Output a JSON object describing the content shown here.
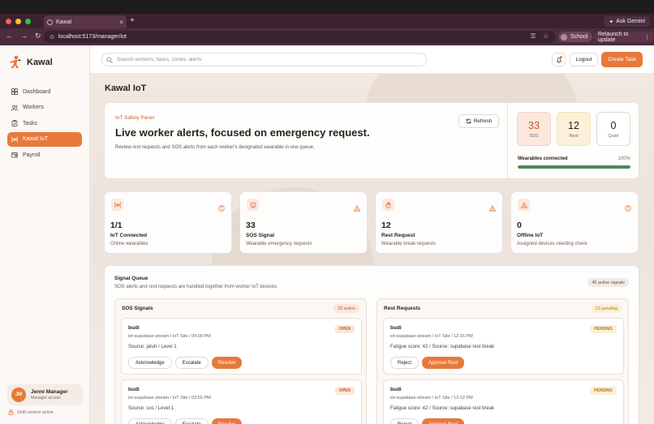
{
  "browser": {
    "tab_title": "Kawal",
    "tab_close": "×",
    "new_tab": "+",
    "ask_gemini": "Ask Gemini",
    "url": "localhost:5173/manager/iot",
    "profile": "School",
    "relaunch": "Relaunch to update"
  },
  "app": {
    "brand": "Kawal",
    "search_placeholder": "Search workers, tasks, zones, alerts",
    "logout": "Logout",
    "create_task": "Create Task"
  },
  "sidebar": {
    "items": [
      {
        "label": "Dashboard",
        "icon": "grid-icon"
      },
      {
        "label": "Workers",
        "icon": "users-icon"
      },
      {
        "label": "Tasks",
        "icon": "clipboard-icon"
      },
      {
        "label": "Kawal IoT",
        "icon": "signal-icon"
      },
      {
        "label": "Payroll",
        "icon": "wallet-icon"
      }
    ],
    "active_index": 3,
    "user": {
      "initials": "JM",
      "name": "Jenni Manager",
      "role": "Manager access"
    },
    "shift_status": "Shift control active"
  },
  "page": {
    "title": "Kawal IoT",
    "hero": {
      "kicker": "IoT Safety Panel",
      "headline": "Live worker alerts, focused on emergency request.",
      "description": "Review rest requests and SOS alerts from each worker's designated wearable in one queue.",
      "refresh": "Refresh"
    },
    "stats": {
      "sos": {
        "value": "33",
        "label": "SOS"
      },
      "rest": {
        "value": "12",
        "label": "Rest"
      },
      "quiet": {
        "value": "0",
        "label": "Quiet"
      }
    },
    "wearables": {
      "label": "Wearables connected",
      "percent_text": "100%",
      "fraction": 1.0
    },
    "metrics": [
      {
        "value": "1/1",
        "title": "IoT Connected",
        "subtitle": "Online wearables",
        "icon": "broadcast-icon",
        "corner_icon": "info-icon"
      },
      {
        "value": "33",
        "title": "SOS Signal",
        "subtitle": "Wearable emergency requests",
        "icon": "shield-icon",
        "corner_icon": "warning-icon"
      },
      {
        "value": "12",
        "title": "Rest Request",
        "subtitle": "Wearable break requests",
        "icon": "hand-icon",
        "corner_icon": "warning-icon"
      },
      {
        "value": "0",
        "title": "Offline IoT",
        "subtitle": "Assigned devices needing check",
        "icon": "warning-icon",
        "corner_icon": "info-icon"
      }
    ],
    "queue": {
      "title": "Signal Queue",
      "subtitle": "SOS alerts and rest requests are handled together from worker IoT devices.",
      "active_signals": "45 active signals",
      "sos": {
        "title": "SOS Signals",
        "count": "33 active",
        "items": [
          {
            "name": "budi",
            "meta": "iot-supabase-stream / IoT Site / 04:00 PM",
            "detail": "Source: jatuh / Level 1",
            "status": "OPEN"
          },
          {
            "name": "budi",
            "meta": "iot-supabase-stream / IoT Site / 03:55 PM",
            "detail": "Source: sos / Level 1",
            "status": "OPEN"
          }
        ],
        "actions": {
          "acknowledge": "Acknowledge",
          "escalate": "Escalate",
          "resolve": "Resolve"
        }
      },
      "rest": {
        "title": "Rest Requests",
        "count": "12 pending",
        "items": [
          {
            "name": "budi",
            "meta": "iot-supabase-stream / IoT Site / 12:16 PM",
            "detail": "Fatigue score: 42 / Source: supabase rest break",
            "status": "PENDING"
          },
          {
            "name": "budi",
            "meta": "iot-supabase-stream / IoT Site / 12:12 PM",
            "detail": "Fatigue score: 42 / Source: supabase rest break",
            "status": "PENDING"
          }
        ],
        "actions": {
          "reject": "Reject",
          "approve": "Approve Rest"
        }
      }
    }
  },
  "colors": {
    "accent": "#e8793b",
    "success": "#4a8a5c"
  }
}
